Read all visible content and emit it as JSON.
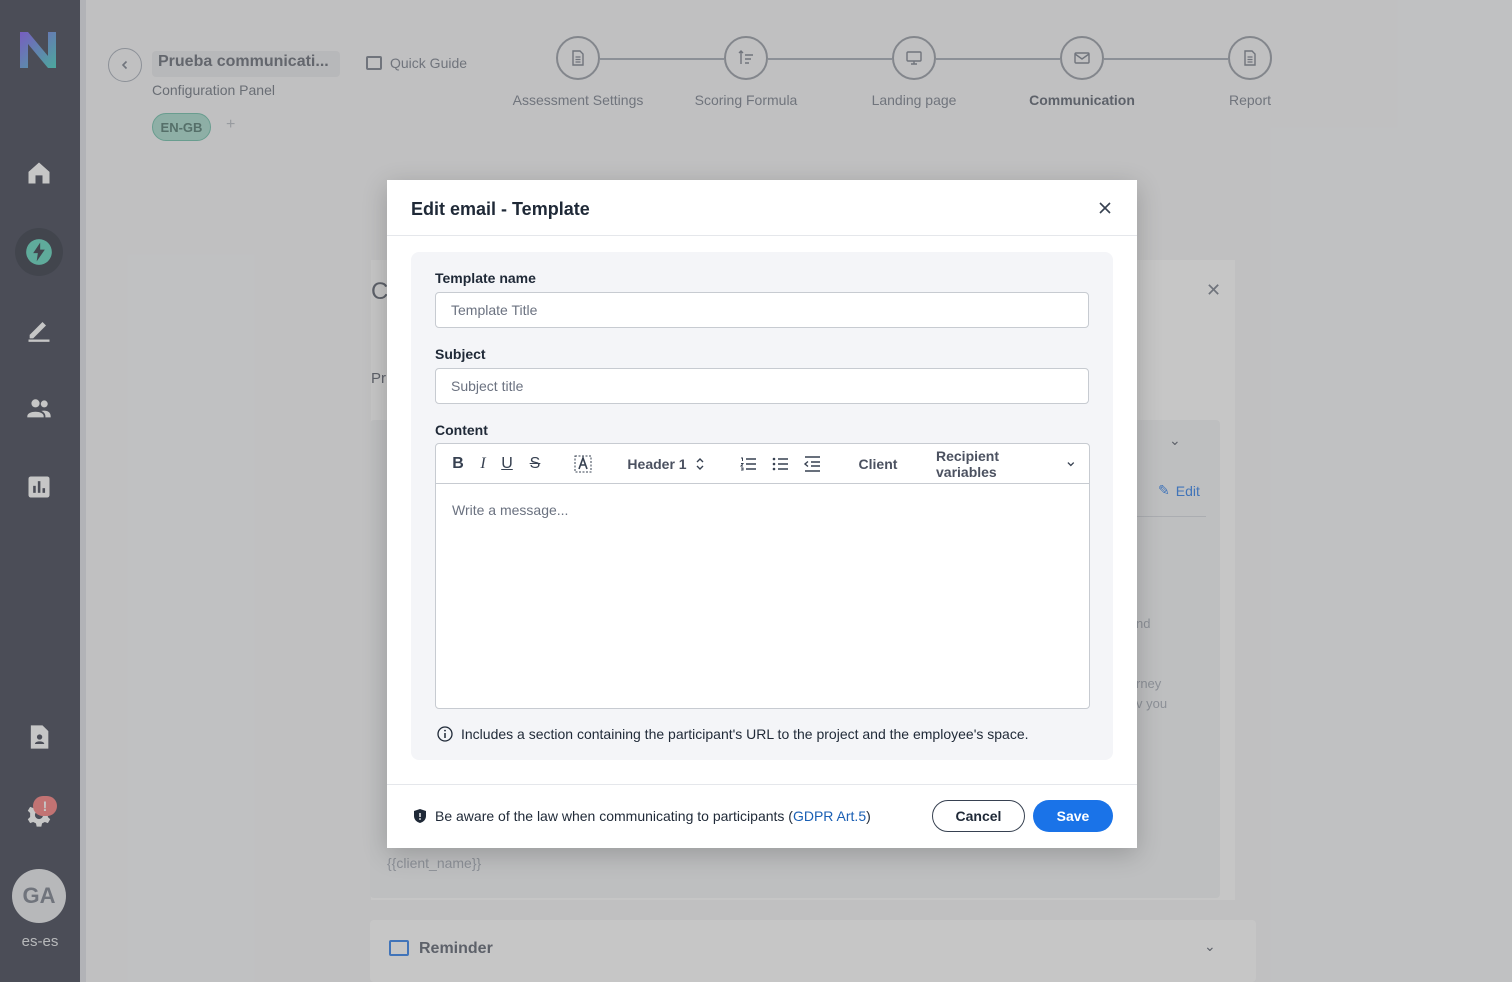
{
  "sidebar": {
    "avatar_initials": "GA",
    "locale": "es-es",
    "settings_badge": "!",
    "nav": [
      "home-icon",
      "bolt-icon",
      "edit-icon",
      "people-icon",
      "chart-icon",
      "document-icon",
      "gear-icon"
    ]
  },
  "header": {
    "project_title": "Prueba communicati...",
    "subtitle": "Configuration Panel",
    "language": "EN-GB",
    "add_language": "+",
    "quick_guide": "Quick Guide"
  },
  "stepper": {
    "steps": [
      {
        "label": "Assessment Settings"
      },
      {
        "label": "Scoring Formula"
      },
      {
        "label": "Landing page"
      },
      {
        "label": "Communication"
      },
      {
        "label": "Report"
      }
    ],
    "active_index": 3
  },
  "background": {
    "section_letter": "C",
    "sub_letters": "Pr",
    "edit_label": "Edit",
    "snippet_1": "nd",
    "snippet_2": "rney",
    "snippet_3": "v you",
    "client_var": "{{client_name}}",
    "reminder_label": "Reminder"
  },
  "modal": {
    "title": "Edit email - Template",
    "template_name_label": "Template name",
    "template_name_placeholder": "Template Title",
    "template_name_value": "",
    "subject_label": "Subject",
    "subject_placeholder": "Subject title",
    "subject_value": "",
    "content_label": "Content",
    "toolbar": {
      "bold": "B",
      "italic": "I",
      "underline": "U",
      "strike": "S",
      "heading": "Header 1",
      "client": "Client",
      "recipient_variables": "Recipient variables"
    },
    "editor_placeholder": "Write a message...",
    "info_text": "Includes a section containing the participant's URL to the project and the employee's space.",
    "gdpr_text": "Be aware of the law when communicating to participants (",
    "gdpr_link": "GDPR Art.5",
    "gdpr_close": ")",
    "cancel_label": "Cancel",
    "save_label": "Save"
  },
  "colors": {
    "sidebar": "#2b3040",
    "accent": "#1a73e8",
    "chip": "#9fd8c9",
    "active_nav": "#4fd1b5"
  }
}
